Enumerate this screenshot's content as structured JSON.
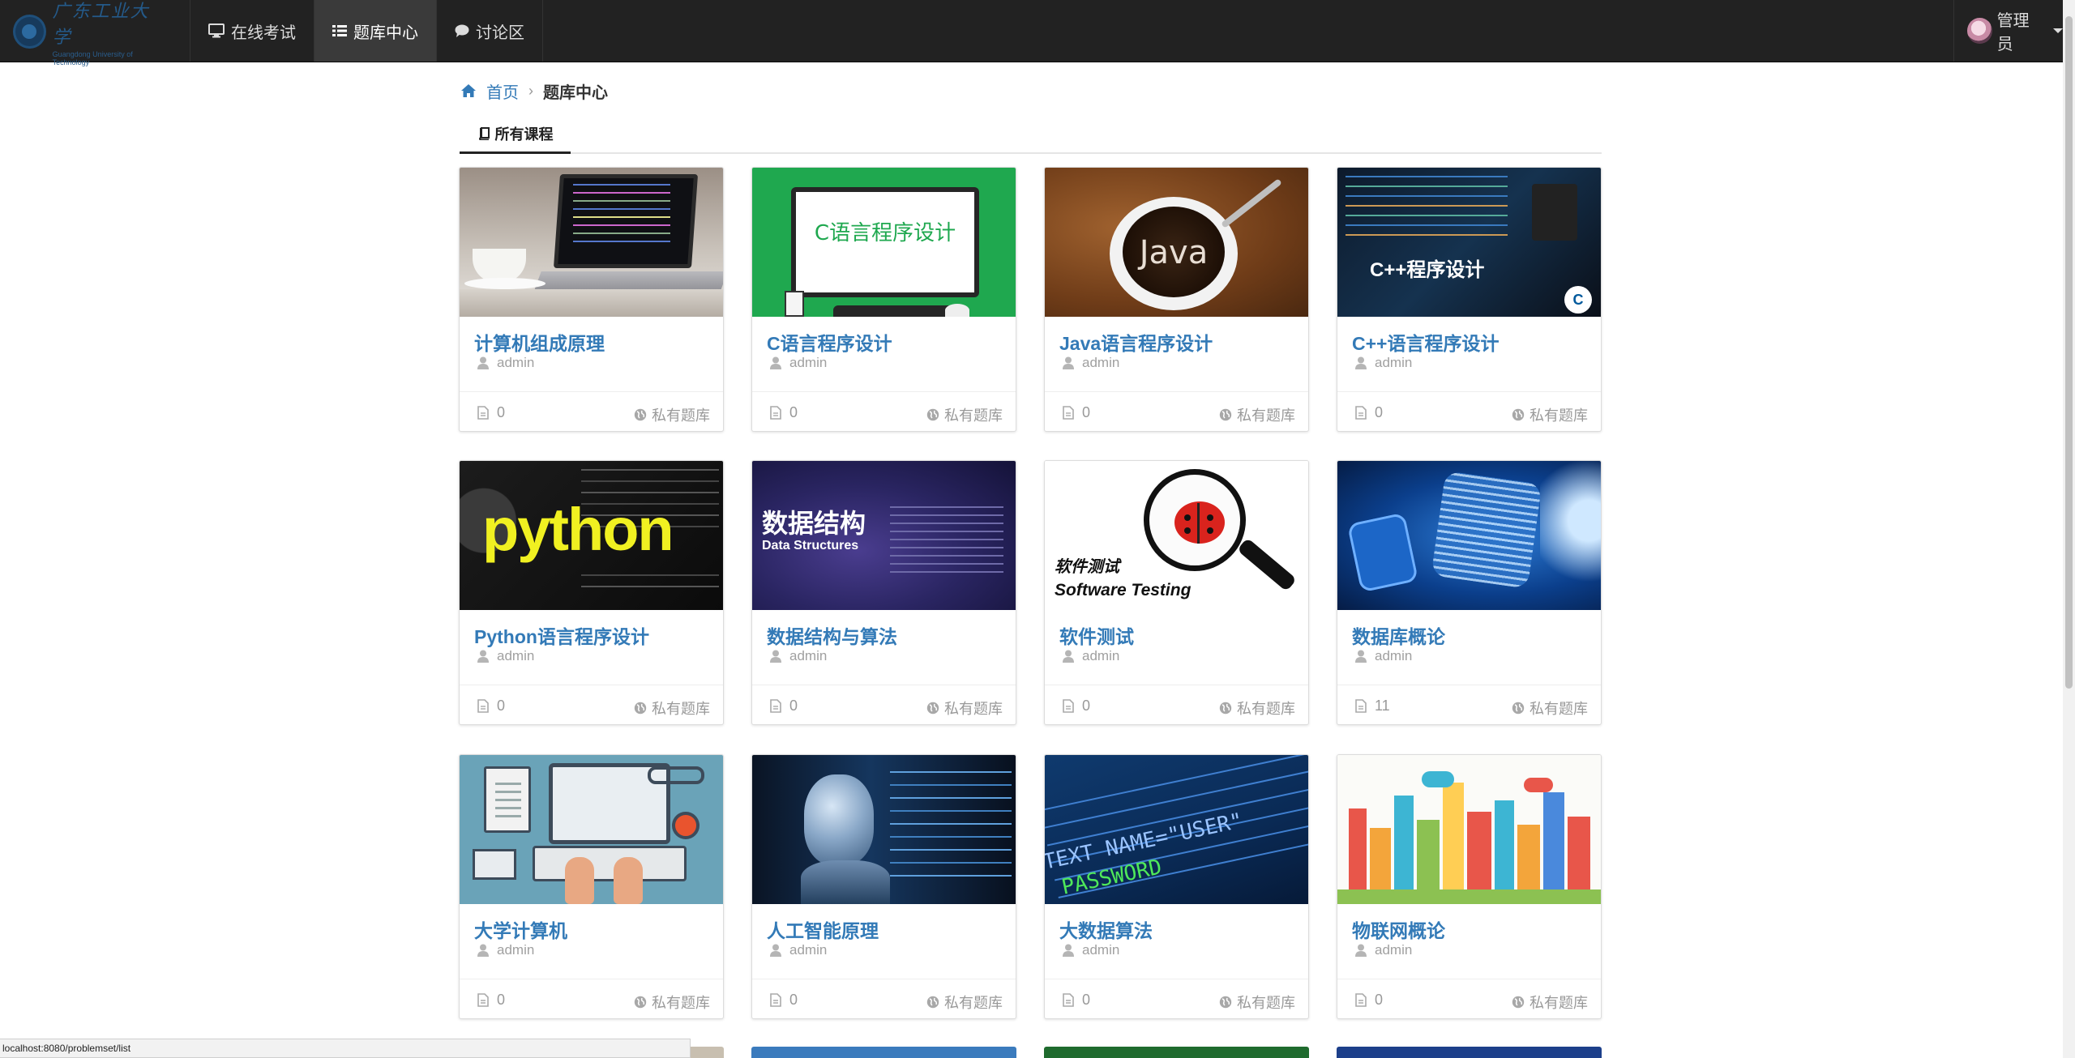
{
  "navbar": {
    "logo": {
      "name_cn": "广东工业大学",
      "name_en": "Guangdong University of Technology"
    },
    "items": [
      {
        "label": "在线考试",
        "icon": "monitor-icon",
        "active": false
      },
      {
        "label": "题库中心",
        "icon": "list-icon",
        "active": true
      },
      {
        "label": "讨论区",
        "icon": "comment-icon",
        "active": false
      }
    ],
    "user": {
      "name": "管理员",
      "icon": "avatar"
    }
  },
  "breadcrumb": {
    "home": "首页",
    "current": "题库中心",
    "icon": "home-icon"
  },
  "tabs": [
    {
      "label": "所有课程",
      "icon": "book-icon",
      "active": true
    }
  ],
  "courses": [
    {
      "title": "计算机组成原理",
      "author": "admin",
      "count": "0",
      "access": "私有题库",
      "thumb": "laptop-coffee"
    },
    {
      "title": "C语言程序设计",
      "author": "admin",
      "count": "0",
      "access": "私有题库",
      "thumb": "c-language",
      "thumb_text": "C语言程序设计"
    },
    {
      "title": "Java语言程序设计",
      "author": "admin",
      "count": "0",
      "access": "私有题库",
      "thumb": "java-coffee",
      "thumb_text": "Java"
    },
    {
      "title": "C++语言程序设计",
      "author": "admin",
      "count": "0",
      "access": "私有题库",
      "thumb": "cpp-laptop",
      "thumb_text": "C++程序设计"
    },
    {
      "title": "Python语言程序设计",
      "author": "admin",
      "count": "0",
      "access": "私有题库",
      "thumb": "python",
      "thumb_text": "python"
    },
    {
      "title": "数据结构与算法",
      "author": "admin",
      "count": "0",
      "access": "私有题库",
      "thumb": "data-structures",
      "thumb_text": "数据结构",
      "thumb_text2": "Data Structures"
    },
    {
      "title": "软件测试",
      "author": "admin",
      "count": "0",
      "access": "私有题库",
      "thumb": "software-testing",
      "thumb_text": "软件测试",
      "thumb_text2": "Software Testing"
    },
    {
      "title": "数据库概论",
      "author": "admin",
      "count": "11",
      "access": "私有题库",
      "thumb": "database-puzzle"
    },
    {
      "title": "大学计算机",
      "author": "admin",
      "count": "0",
      "access": "私有题库",
      "thumb": "office-desk"
    },
    {
      "title": "人工智能原理",
      "author": "admin",
      "count": "0",
      "access": "私有题库",
      "thumb": "ai-robot"
    },
    {
      "title": "大数据算法",
      "author": "admin",
      "count": "0",
      "access": "私有题库",
      "thumb": "big-data-code",
      "thumb_text": "TEXT NAME=\"USER\"",
      "thumb_text2": "PASSWORD"
    },
    {
      "title": "物联网概论",
      "author": "admin",
      "count": "0",
      "access": "私有题库",
      "thumb": "iot-city"
    }
  ],
  "colors": {
    "navbar": "#222222",
    "link": "#337ab7",
    "muted": "#999999"
  },
  "status_url": "localhost:8080/problemset/list"
}
